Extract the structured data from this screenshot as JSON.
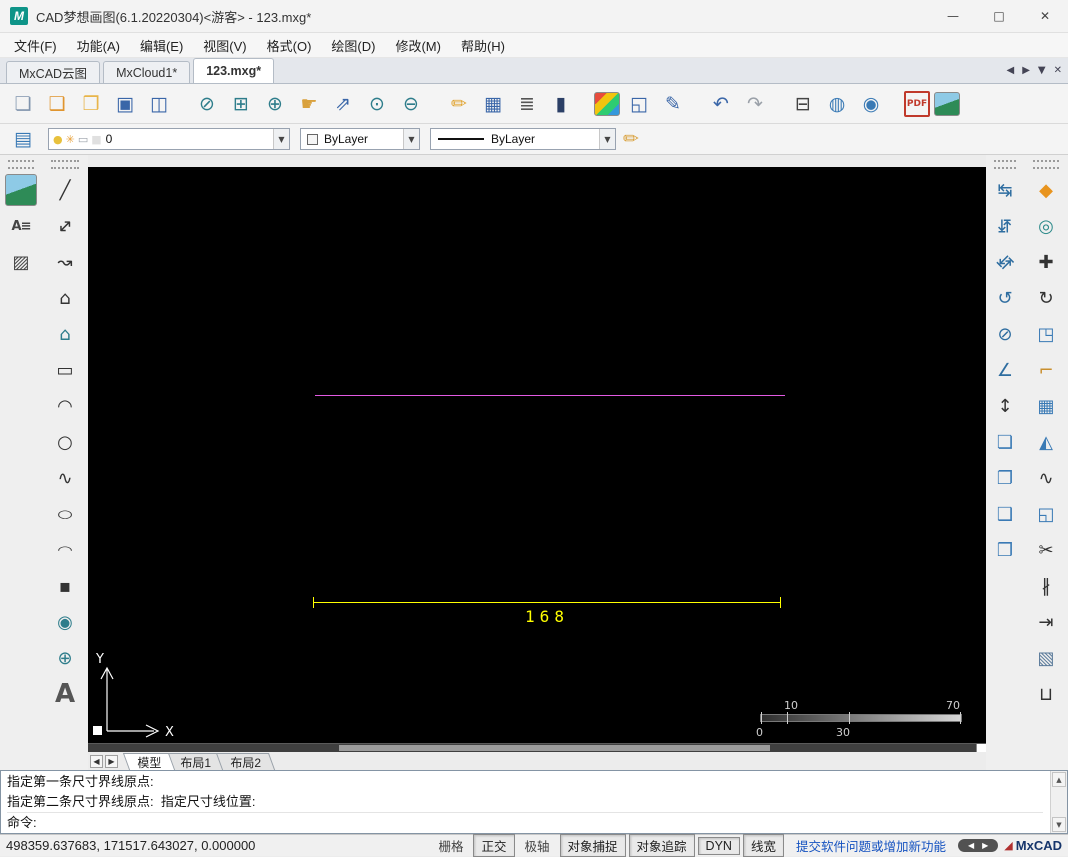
{
  "window": {
    "title": "CAD梦想画图(6.1.20220304)<游客> - 123.mxg*",
    "logo_glyph": "M",
    "minimize": "—",
    "maximize": "□",
    "close": "✕"
  },
  "menu": {
    "items": [
      {
        "name": "menu-file",
        "label": "文件(F)"
      },
      {
        "name": "menu-function",
        "label": "功能(A)"
      },
      {
        "name": "menu-edit",
        "label": "编辑(E)"
      },
      {
        "name": "menu-view",
        "label": "视图(V)"
      },
      {
        "name": "menu-format",
        "label": "格式(O)"
      },
      {
        "name": "menu-draw",
        "label": "绘图(D)"
      },
      {
        "name": "menu-modify",
        "label": "修改(M)"
      },
      {
        "name": "menu-help",
        "label": "帮助(H)"
      }
    ]
  },
  "doc_tabs": {
    "tabs": [
      {
        "name": "tab-mxcad-cloud",
        "label": "MxCAD云图",
        "cls": ""
      },
      {
        "name": "tab-mxcloud1",
        "label": "MxCloud1*",
        "cls": ""
      },
      {
        "name": "tab-123mxg",
        "label": "123.mxg*",
        "cls": "active"
      }
    ],
    "controls": [
      {
        "name": "tabs-scroll-left-icon",
        "glyph": "◀"
      },
      {
        "name": "tabs-scroll-right-icon",
        "glyph": "▶"
      },
      {
        "name": "tabs-list-icon",
        "glyph": "▼"
      },
      {
        "name": "tabs-close-icon",
        "glyph": "✕"
      }
    ]
  },
  "toolbar_main": [
    {
      "name": "new-file-icon",
      "glyph": "❏",
      "color": "#8094ad"
    },
    {
      "name": "open-template-icon",
      "glyph": "❑",
      "color": "#e0952f"
    },
    {
      "name": "open-file-icon",
      "glyph": "❒",
      "color": "#e8b54a"
    },
    {
      "name": "save-icon",
      "glyph": "▣",
      "color": "#3a66a8"
    },
    {
      "name": "save-all-icon",
      "glyph": "◫",
      "color": "#3a66a8"
    },
    {
      "name": "zoom-previous-icon",
      "glyph": "⊘",
      "color": "#2e7d8b",
      "cls": "gap"
    },
    {
      "name": "zoom-window-icon",
      "glyph": "⊞",
      "color": "#2e7d8b"
    },
    {
      "name": "zoom-in-icon",
      "glyph": "⊕",
      "color": "#2e7d8b"
    },
    {
      "name": "pan-icon",
      "glyph": "☛",
      "color": "#d9a13d"
    },
    {
      "name": "dynamic-zoom-icon",
      "glyph": "⇗",
      "color": "#3a66a8"
    },
    {
      "name": "zoom-extents-icon",
      "glyph": "⊙",
      "color": "#2e7d8b"
    },
    {
      "name": "zoom-out-icon",
      "glyph": "⊖",
      "color": "#2e7d8b"
    },
    {
      "name": "redline-pencil-icon",
      "glyph": "✏",
      "color": "#e0a32f",
      "cls": "gap"
    },
    {
      "name": "table-icon",
      "glyph": "▦",
      "color": "#3a66a8"
    },
    {
      "name": "text-format-icon",
      "glyph": "≣",
      "color": "#555555"
    },
    {
      "name": "properties-panel-icon",
      "glyph": "▮",
      "color": "#2b3f66"
    },
    {
      "name": "color-palette-icon",
      "glyph": "▦",
      "cls": "gap palette"
    },
    {
      "name": "named-views-icon",
      "glyph": "◱",
      "color": "#3a66a8"
    },
    {
      "name": "edit-redline-icon",
      "glyph": "✎",
      "color": "#3a66a8"
    },
    {
      "name": "undo-icon",
      "glyph": "↶",
      "color": "#3a66a8",
      "cls": "gap"
    },
    {
      "name": "redo-icon",
      "glyph": "↷",
      "color": "#9aa0a8"
    },
    {
      "name": "print-icon",
      "glyph": "⊟",
      "color": "#444444",
      "cls": "gap"
    },
    {
      "name": "web-browse-icon",
      "glyph": "◍",
      "color": "#3a7ab5"
    },
    {
      "name": "web-publish-icon",
      "glyph": "◉",
      "color": "#3a7ab5"
    },
    {
      "name": "pdf-export-icon",
      "glyph": "PDF",
      "color": "#c0392b",
      "cls": "gap pdf"
    },
    {
      "name": "insert-image-icon",
      "glyph": "",
      "cls": "img"
    }
  ],
  "toolbar_props": {
    "layers_icon": "▤",
    "layer_combo": {
      "icons": [
        {
          "name": "layer-on-icon",
          "glyph": "●",
          "color": "#e8c13d"
        },
        {
          "name": "layer-freeze-icon",
          "glyph": "✳",
          "color": "#e8a23d"
        },
        {
          "name": "layer-lock-icon",
          "glyph": "▭",
          "color": "#9aa0a8"
        },
        {
          "name": "layer-color-icon",
          "glyph": "■",
          "color": "#e0e0e0"
        }
      ],
      "value": "0"
    },
    "color_combo": {
      "value": "ByLayer"
    },
    "linetype_combo": {
      "value": "ByLayer"
    },
    "arrow": "▼",
    "draworder_icon": "✏"
  },
  "left_tools_a": [
    {
      "name": "insert-raster-image-icon",
      "glyph": "",
      "cls": "img"
    },
    {
      "name": "text-style-icon",
      "glyph": "A≡",
      "color": "#444444",
      "cls": "small2"
    },
    {
      "name": "hatch-icon",
      "glyph": "▨",
      "color": "#444444"
    }
  ],
  "left_tools_b": [
    {
      "name": "line-icon",
      "glyph": "╱",
      "color": "#333333"
    },
    {
      "name": "construction-line-icon",
      "glyph": "↔",
      "color": "#333333",
      "cls": "rot45"
    },
    {
      "name": "polyline-icon",
      "glyph": "↝",
      "color": "#333333"
    },
    {
      "name": "polygon-icon",
      "glyph": "⌂",
      "color": "#333333"
    },
    {
      "name": "inscribed-polygon-icon",
      "glyph": "⌂",
      "color": "#2e7d8b"
    },
    {
      "name": "rectangle-icon",
      "glyph": "▭",
      "color": "#333333"
    },
    {
      "name": "arc-icon",
      "glyph": "◠",
      "color": "#333333"
    },
    {
      "name": "circle-icon",
      "glyph": "○",
      "color": "#333333"
    },
    {
      "name": "spline-icon",
      "glyph": "∿",
      "color": "#333333"
    },
    {
      "name": "ellipse-icon",
      "glyph": "○",
      "color": "#333333",
      "cls": "squish"
    },
    {
      "name": "ellipse-arc-icon",
      "glyph": "◠",
      "color": "#333333",
      "cls": "squish"
    },
    {
      "name": "point-icon",
      "glyph": "▪",
      "color": "#333333"
    },
    {
      "name": "donut-icon",
      "glyph": "◉",
      "color": "#2e7d8b"
    },
    {
      "name": "region-icon",
      "glyph": "⊕",
      "color": "#2e7d8b"
    },
    {
      "name": "text-icon",
      "glyph": "A",
      "color": "#555555",
      "cls": "big"
    }
  ],
  "right_tools_a": [
    {
      "name": "dim-aligned-icon",
      "glyph": "↹",
      "color": "#2e6da0"
    },
    {
      "name": "dim-linear-icon",
      "glyph": "↹",
      "color": "#2e6da0",
      "cls": "rot90"
    },
    {
      "name": "dim-rotated-icon",
      "glyph": "↹",
      "color": "#2e6da0",
      "cls": "rot45"
    },
    {
      "name": "dim-radius-icon",
      "glyph": "↺",
      "color": "#2e6da0"
    },
    {
      "name": "dim-diameter-icon",
      "glyph": "⊘",
      "color": "#2e6da0"
    },
    {
      "name": "dim-angular-icon",
      "glyph": "∠",
      "color": "#2e6da0"
    },
    {
      "name": "dim-ordinate-icon",
      "glyph": "↕",
      "color": "#333333"
    },
    {
      "name": "quick-dim-icon",
      "glyph": "❏",
      "color": "#3a7ab5"
    },
    {
      "name": "baseline-dim-icon",
      "glyph": "❐",
      "color": "#3a7ab5"
    },
    {
      "name": "continue-dim-icon",
      "glyph": "❑",
      "color": "#3a7ab5"
    },
    {
      "name": "leader-icon",
      "glyph": "❒",
      "color": "#3a7ab5"
    }
  ],
  "right_tools_b": [
    {
      "name": "erase-icon",
      "glyph": "◆",
      "color": "#e8941e"
    },
    {
      "name": "copy-icon",
      "glyph": "◎",
      "color": "#2e8b8b"
    },
    {
      "name": "move-icon",
      "glyph": "✚",
      "color": "#333333"
    },
    {
      "name": "rotate-icon",
      "glyph": "↻",
      "color": "#333333"
    },
    {
      "name": "stretch-icon",
      "glyph": "◳",
      "color": "#3a7ab5"
    },
    {
      "name": "offset-icon",
      "glyph": "⌐",
      "color": "#c98f2e"
    },
    {
      "name": "array-icon",
      "glyph": "▦",
      "color": "#3a7ab5"
    },
    {
      "name": "mirror-icon",
      "glyph": "◭",
      "color": "#3a7ab5"
    },
    {
      "name": "edit-polyline-icon",
      "glyph": "∿",
      "color": "#333333"
    },
    {
      "name": "scale-icon",
      "glyph": "◱",
      "color": "#3a7ab5"
    },
    {
      "name": "trim-icon",
      "glyph": "✂",
      "color": "#333333"
    },
    {
      "name": "break-icon",
      "glyph": "∦",
      "color": "#333333"
    },
    {
      "name": "extend-icon",
      "glyph": "⇥",
      "color": "#333333"
    },
    {
      "name": "explode-3d-icon",
      "glyph": "▧",
      "color": "#5a7a9a"
    },
    {
      "name": "explode-icon",
      "glyph": "⊔",
      "color": "#333333"
    }
  ],
  "canvas": {
    "dim_text": "168",
    "ucs": {
      "x_label": "X",
      "y_label": "Y"
    },
    "ruler": {
      "top_left": "10",
      "top_right": "70",
      "bottom_left": "0",
      "bottom_mid": "30"
    }
  },
  "layout_tabs": [
    {
      "name": "layout-tab-model",
      "label": "模型",
      "cls": "active"
    },
    {
      "name": "layout-tab-layout1",
      "label": "布局1",
      "cls": ""
    },
    {
      "name": "layout-tab-layout2",
      "label": "布局2",
      "cls": ""
    }
  ],
  "command": {
    "lines": [
      {
        "name": "prompt-line-1",
        "text": "指定第一条尺寸界线原点:"
      },
      {
        "name": "prompt-line-2",
        "text": "指定第二条尺寸界线原点:  指定尺寸线位置:"
      },
      {
        "name": "command-prompt",
        "text": "命令:"
      }
    ]
  },
  "status": {
    "coords": "498359.637683,  171517.643027,  0.000000",
    "toggles": [
      {
        "name": "toggle-grid",
        "label": "栅格",
        "cls": "flat"
      },
      {
        "name": "toggle-ortho",
        "label": "正交",
        "cls": "pressed"
      },
      {
        "name": "toggle-polar",
        "label": "极轴",
        "cls": "flat"
      },
      {
        "name": "toggle-osnap",
        "label": "对象捕捉",
        "cls": "pressed"
      },
      {
        "name": "toggle-otrack",
        "label": "对象追踪",
        "cls": "pressed"
      },
      {
        "name": "toggle-dyn",
        "label": "DYN",
        "cls": "pressed"
      },
      {
        "name": "toggle-lineweight",
        "label": "线宽",
        "cls": "pressed"
      }
    ],
    "link": "提交软件问题或增加新功能",
    "brand": "MxCAD"
  },
  "ui": {
    "nav_left": "◀",
    "nav_right": "▶",
    "arrow_up": "▲",
    "arrow_down": "▼",
    "brand_mark": "◢"
  }
}
